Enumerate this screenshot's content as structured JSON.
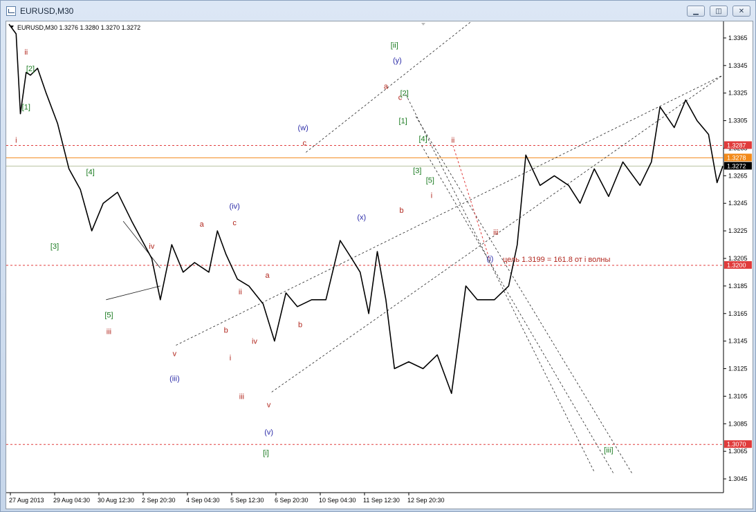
{
  "window": {
    "title": "EURUSD,M30",
    "buttons": {
      "minimize": "▁",
      "restore": "◫",
      "close": "✕"
    }
  },
  "chart_header": "EURUSD,M30  1.3276 1.3280 1.3270 1.3272",
  "chart_data": {
    "type": "line",
    "symbol": "EURUSD",
    "timeframe": "M30",
    "ohlc": {
      "open": 1.3276,
      "high": 1.328,
      "low": 1.327,
      "close": 1.3272
    },
    "ylim": [
      1.3035,
      1.3375
    ],
    "y_ticks": [
      1.3365,
      1.3345,
      1.3325,
      1.3305,
      1.3285,
      1.3265,
      1.3245,
      1.3225,
      1.3205,
      1.3185,
      1.3165,
      1.3145,
      1.3125,
      1.3105,
      1.3085,
      1.3065,
      1.3045
    ],
    "x_ticks": [
      "27 Aug 2013",
      "29 Aug 04:30",
      "30 Aug 12:30",
      "2 Sep 20:30",
      "4 Sep 04:30",
      "5 Sep 12:30",
      "6 Sep 20:30",
      "10 Sep 04:30",
      "11 Sep 12:30",
      "12 Sep 20:30"
    ],
    "x_range": [
      0,
      500
    ],
    "price_path": [
      [
        0,
        1.3375
      ],
      [
        5,
        1.3368
      ],
      [
        8,
        1.331
      ],
      [
        12,
        1.334
      ],
      [
        15,
        1.3338
      ],
      [
        20,
        1.3343
      ],
      [
        26,
        1.3325
      ],
      [
        34,
        1.3303
      ],
      [
        42,
        1.327
      ],
      [
        50,
        1.3255
      ],
      [
        58,
        1.3225
      ],
      [
        66,
        1.3245
      ],
      [
        76,
        1.3253
      ],
      [
        86,
        1.3232
      ],
      [
        100,
        1.3205
      ],
      [
        106,
        1.3175
      ],
      [
        114,
        1.3215
      ],
      [
        122,
        1.3195
      ],
      [
        130,
        1.3202
      ],
      [
        140,
        1.3195
      ],
      [
        146,
        1.3225
      ],
      [
        152,
        1.3208
      ],
      [
        160,
        1.319
      ],
      [
        168,
        1.3185
      ],
      [
        178,
        1.3172
      ],
      [
        186,
        1.3145
      ],
      [
        194,
        1.318
      ],
      [
        202,
        1.317
      ],
      [
        212,
        1.3175
      ],
      [
        222,
        1.3175
      ],
      [
        232,
        1.3218
      ],
      [
        240,
        1.3205
      ],
      [
        246,
        1.3195
      ],
      [
        252,
        1.3165
      ],
      [
        258,
        1.321
      ],
      [
        264,
        1.3175
      ],
      [
        270,
        1.3125
      ],
      [
        280,
        1.313
      ],
      [
        290,
        1.3125
      ],
      [
        300,
        1.3135
      ],
      [
        310,
        1.3107
      ],
      [
        314,
        1.3138
      ],
      [
        320,
        1.3185
      ],
      [
        328,
        1.3175
      ],
      [
        340,
        1.3175
      ],
      [
        350,
        1.3185
      ],
      [
        356,
        1.3215
      ],
      [
        362,
        1.328
      ],
      [
        372,
        1.3258
      ],
      [
        382,
        1.3265
      ],
      [
        392,
        1.3258
      ],
      [
        400,
        1.3245
      ],
      [
        410,
        1.327
      ],
      [
        420,
        1.325
      ],
      [
        430,
        1.3275
      ],
      [
        442,
        1.3258
      ],
      [
        450,
        1.3275
      ],
      [
        456,
        1.3315
      ],
      [
        466,
        1.33
      ],
      [
        474,
        1.332
      ],
      [
        482,
        1.3305
      ],
      [
        490,
        1.3295
      ],
      [
        496,
        1.326
      ],
      [
        500,
        1.3272
      ]
    ],
    "horizontal_levels": [
      {
        "price": 1.3287,
        "label": "1.3287",
        "color": "#e03b3b",
        "style": "dashed"
      },
      {
        "price": 1.3278,
        "label": "1.3278",
        "color": "#f28a1a",
        "style": "solid"
      },
      {
        "price": 1.3272,
        "label": "1.3272",
        "color": "#000000",
        "style": "current"
      },
      {
        "price": 1.32,
        "label": "1.3200",
        "color": "#e03b3b",
        "style": "dashed"
      },
      {
        "price": 1.307,
        "label": "1.3070",
        "color": "#e03b3b",
        "style": "dashed"
      }
    ],
    "annotation": "цель 1.3199 = 161.8 от i волны",
    "colors": {
      "price": "#000000",
      "wave_red": "#b1261d",
      "wave_green": "#197a1f",
      "wave_blue": "#2c2ca8",
      "level_red": "#e03b3b",
      "level_orange": "#f28a1a"
    },
    "wave_labels": [
      {
        "text": "ii",
        "color": "red",
        "x": 12,
        "price": 1.3353
      },
      {
        "text": "[2]",
        "color": "green",
        "x": 15,
        "price": 1.3341
      },
      {
        "text": "[1]",
        "color": "green",
        "x": 12,
        "price": 1.3313
      },
      {
        "text": "i",
        "color": "red",
        "x": 5,
        "price": 1.3289
      },
      {
        "text": "[4]",
        "color": "green",
        "x": 57,
        "price": 1.3266
      },
      {
        "text": "[3]",
        "color": "green",
        "x": 32,
        "price": 1.3212
      },
      {
        "text": "iv",
        "color": "red",
        "x": 100,
        "price": 1.3212
      },
      {
        "text": "[5]",
        "color": "green",
        "x": 70,
        "price": 1.3162
      },
      {
        "text": "iii",
        "color": "red",
        "x": 70,
        "price": 1.315
      },
      {
        "text": "v",
        "color": "red",
        "x": 116,
        "price": 1.3134
      },
      {
        "text": "(iii)",
        "color": "blue",
        "x": 116,
        "price": 1.3116
      },
      {
        "text": "a",
        "color": "red",
        "x": 135,
        "price": 1.3228
      },
      {
        "text": "(iv)",
        "color": "blue",
        "x": 158,
        "price": 1.3241
      },
      {
        "text": "c",
        "color": "red",
        "x": 158,
        "price": 1.3229
      },
      {
        "text": "b",
        "color": "red",
        "x": 152,
        "price": 1.3151
      },
      {
        "text": "ii",
        "color": "red",
        "x": 162,
        "price": 1.3179
      },
      {
        "text": "iv",
        "color": "red",
        "x": 172,
        "price": 1.3143
      },
      {
        "text": "i",
        "color": "red",
        "x": 155,
        "price": 1.3131
      },
      {
        "text": "iii",
        "color": "red",
        "x": 163,
        "price": 1.3103
      },
      {
        "text": "a",
        "color": "red",
        "x": 181,
        "price": 1.3191
      },
      {
        "text": "b",
        "color": "red",
        "x": 204,
        "price": 1.3155
      },
      {
        "text": "v",
        "color": "red",
        "x": 182,
        "price": 1.3097
      },
      {
        "text": "(v)",
        "color": "blue",
        "x": 182,
        "price": 1.3077
      },
      {
        "text": "[i]",
        "color": "green",
        "x": 180,
        "price": 1.3062
      },
      {
        "text": "(w)",
        "color": "blue",
        "x": 206,
        "price": 1.3298
      },
      {
        "text": "c",
        "color": "red",
        "x": 207,
        "price": 1.3287
      },
      {
        "text": "(x)",
        "color": "blue",
        "x": 247,
        "price": 1.3233
      },
      {
        "text": "[ii]",
        "color": "green",
        "x": 270,
        "price": 1.3358
      },
      {
        "text": "(y)",
        "color": "blue",
        "x": 272,
        "price": 1.3347
      },
      {
        "text": "a",
        "color": "red",
        "x": 264,
        "price": 1.3328
      },
      {
        "text": "c",
        "color": "red",
        "x": 274,
        "price": 1.332
      },
      {
        "text": "[2]",
        "color": "green",
        "x": 277,
        "price": 1.3323
      },
      {
        "text": "[1]",
        "color": "green",
        "x": 276,
        "price": 1.3303
      },
      {
        "text": "[4]",
        "color": "green",
        "x": 290,
        "price": 1.329
      },
      {
        "text": "[3]",
        "color": "green",
        "x": 286,
        "price": 1.3267
      },
      {
        "text": "[5]",
        "color": "green",
        "x": 295,
        "price": 1.326
      },
      {
        "text": "ii",
        "color": "red",
        "x": 311,
        "price": 1.3289
      },
      {
        "text": "b",
        "color": "red",
        "x": 275,
        "price": 1.3238
      },
      {
        "text": "i",
        "color": "red",
        "x": 296,
        "price": 1.3249
      },
      {
        "text": "iii",
        "color": "red",
        "x": 341,
        "price": 1.3222
      },
      {
        "text": "(i)",
        "color": "blue",
        "x": 337,
        "price": 1.3203
      },
      {
        "text": "[iii]",
        "color": "green",
        "x": 420,
        "price": 1.3064
      }
    ],
    "trend_lines": [
      [
        [
          208,
          1.3282
        ],
        [
          347,
          1.3396
        ]
      ],
      [
        [
          117,
          1.3142
        ],
        [
          500,
          1.3338
        ]
      ],
      [
        [
          184,
          1.3108
        ],
        [
          500,
          1.3338
        ]
      ],
      [
        [
          278,
          1.3324
        ],
        [
          410,
          1.305
        ]
      ],
      [
        [
          285,
          1.3308
        ],
        [
          437,
          1.3048
        ]
      ],
      [
        [
          289,
          1.3287
        ],
        [
          424,
          1.3048
        ]
      ],
      [
        [
          68,
          1.3175
        ],
        [
          106,
          1.3185
        ]
      ],
      [
        [
          80,
          1.3232
        ],
        [
          106,
          1.3198
        ]
      ]
    ]
  }
}
